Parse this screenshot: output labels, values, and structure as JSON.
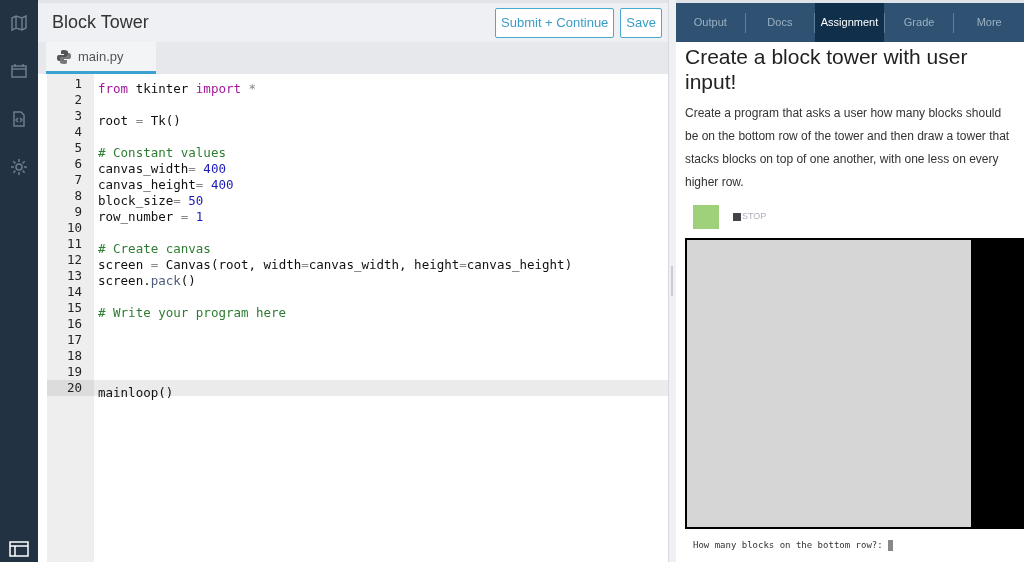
{
  "header": {
    "title": "Block Tower",
    "buttons": [
      "Submit + Continue",
      "Save"
    ]
  },
  "file_tab": {
    "label": "main.py",
    "selected": true
  },
  "code": [
    {
      "number": "1",
      "current": false,
      "tokens": [
        {
          "kind": "kw",
          "t": "from"
        },
        {
          "kind": "tx",
          "t": " tkinter "
        },
        {
          "kind": "kw",
          "t": "import"
        },
        {
          "kind": "op",
          "t": " *"
        }
      ]
    },
    {
      "number": "2",
      "current": false
    },
    {
      "number": "3",
      "current": false,
      "tokens": [
        {
          "kind": "tx",
          "t": "root "
        },
        {
          "kind": "op",
          "t": "="
        },
        {
          "kind": "tx",
          "t": " Tk()"
        }
      ]
    },
    {
      "number": "4",
      "current": false
    },
    {
      "number": "5",
      "current": false,
      "tokens": [
        {
          "kind": "cm",
          "t": "# Constant values"
        }
      ]
    },
    {
      "number": "6",
      "current": false,
      "tokens": [
        {
          "kind": "tx",
          "t": "canvas_width"
        },
        {
          "kind": "op",
          "t": "="
        },
        {
          "kind": "num",
          "t": " 400"
        }
      ]
    },
    {
      "number": "7",
      "current": false,
      "tokens": [
        {
          "kind": "tx",
          "t": "canvas_height"
        },
        {
          "kind": "op",
          "t": "="
        },
        {
          "kind": "num",
          "t": " 400"
        }
      ]
    },
    {
      "number": "8",
      "current": false,
      "tokens": [
        {
          "kind": "tx",
          "t": "block_size"
        },
        {
          "kind": "op",
          "t": "="
        },
        {
          "kind": "num",
          "t": " 50"
        }
      ]
    },
    {
      "number": "9",
      "current": false,
      "tokens": [
        {
          "kind": "tx",
          "t": "row_number "
        },
        {
          "kind": "op",
          "t": "="
        },
        {
          "kind": "num",
          "t": " 1"
        }
      ]
    },
    {
      "number": "10",
      "current": false
    },
    {
      "number": "11",
      "current": false,
      "tokens": [
        {
          "kind": "cm",
          "t": "# Create canvas"
        }
      ]
    },
    {
      "number": "12",
      "current": false,
      "tokens": [
        {
          "kind": "tx",
          "t": "screen "
        },
        {
          "kind": "op",
          "t": "="
        },
        {
          "kind": "tx",
          "t": " Canvas(root, width"
        },
        {
          "kind": "op",
          "t": "="
        },
        {
          "kind": "tx",
          "t": "canvas_width, height"
        },
        {
          "kind": "op",
          "t": "="
        },
        {
          "kind": "tx",
          "t": "canvas_height)"
        }
      ]
    },
    {
      "number": "13",
      "current": false,
      "tokens": [
        {
          "kind": "tx",
          "t": "screen."
        },
        {
          "kind": "fn",
          "t": "pack"
        },
        {
          "kind": "tx",
          "t": "()"
        }
      ]
    },
    {
      "number": "14",
      "current": false
    },
    {
      "number": "15",
      "current": false,
      "tokens": [
        {
          "kind": "cm",
          "t": "# Write your program here"
        }
      ]
    },
    {
      "number": "16",
      "current": false
    },
    {
      "number": "17",
      "current": false
    },
    {
      "number": "18",
      "current": false
    },
    {
      "number": "19",
      "current": false
    },
    {
      "number": "20",
      "current": true,
      "tokens": [
        {
          "kind": "tx",
          "t": "mainloop()"
        }
      ]
    }
  ],
  "right_tabs": [
    {
      "label": "Output",
      "selected": false
    },
    {
      "label": "Docs",
      "selected": false
    },
    {
      "label": "Assignment",
      "selected": true
    },
    {
      "label": "Grade",
      "selected": false
    },
    {
      "label": "More",
      "selected": false
    }
  ],
  "assignment": {
    "title": "Create a block tower with user input!",
    "body": "Create a program that asks a user how many blocks should be on the bottom row of the tower and then draw a tower that stacks blocks on top of one another, with one less on every higher row."
  },
  "runner": {
    "stop": "STOP",
    "console": "How many blocks on the bottom row?: "
  }
}
